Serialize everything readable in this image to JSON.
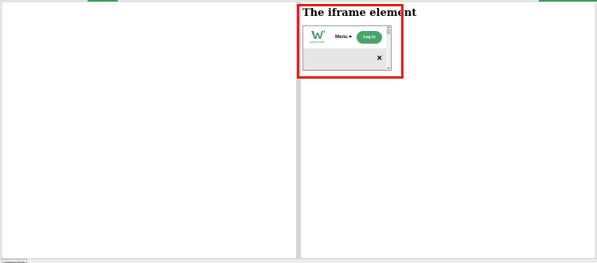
{
  "page": {
    "heading": "The iframe element",
    "status_label": "Unsaved Work"
  },
  "iframe": {
    "logo": {
      "icon": "w3schools-logo-icon",
      "subtext": "w3schools"
    },
    "menu_label": "Menu",
    "login_label": "Log in",
    "close_symbol": "✕"
  },
  "colors": {
    "accent_green": "#3a9a5b",
    "login_green": "#4aa36b",
    "highlight_red": "#e41b1b",
    "banner_gray": "#e6e7e8"
  }
}
